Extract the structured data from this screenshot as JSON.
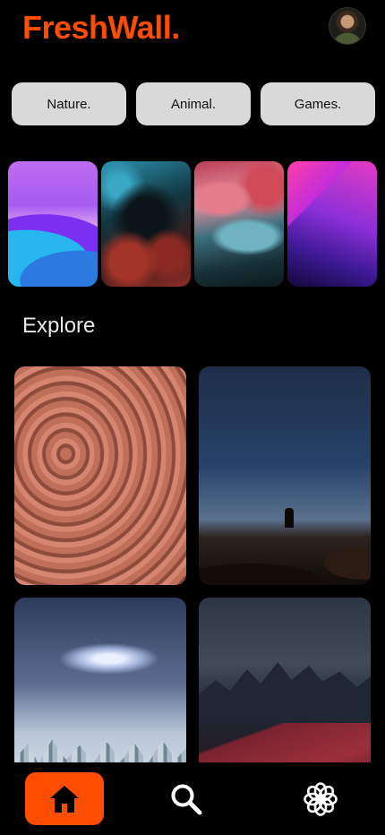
{
  "app": {
    "title": "FreshWall."
  },
  "categories": [
    {
      "label": "Nature."
    },
    {
      "label": "Animal."
    },
    {
      "label": "Games."
    }
  ],
  "explore": {
    "title": "Explore"
  },
  "nav": {
    "items": [
      {
        "name": "home",
        "icon": "home-icon",
        "active": true
      },
      {
        "name": "search",
        "icon": "search-icon",
        "active": false
      },
      {
        "name": "collections",
        "icon": "flower-icon",
        "active": false
      }
    ]
  },
  "colors": {
    "accent": "#ff4d00",
    "background": "#000000",
    "chip": "#d9d9d9"
  }
}
